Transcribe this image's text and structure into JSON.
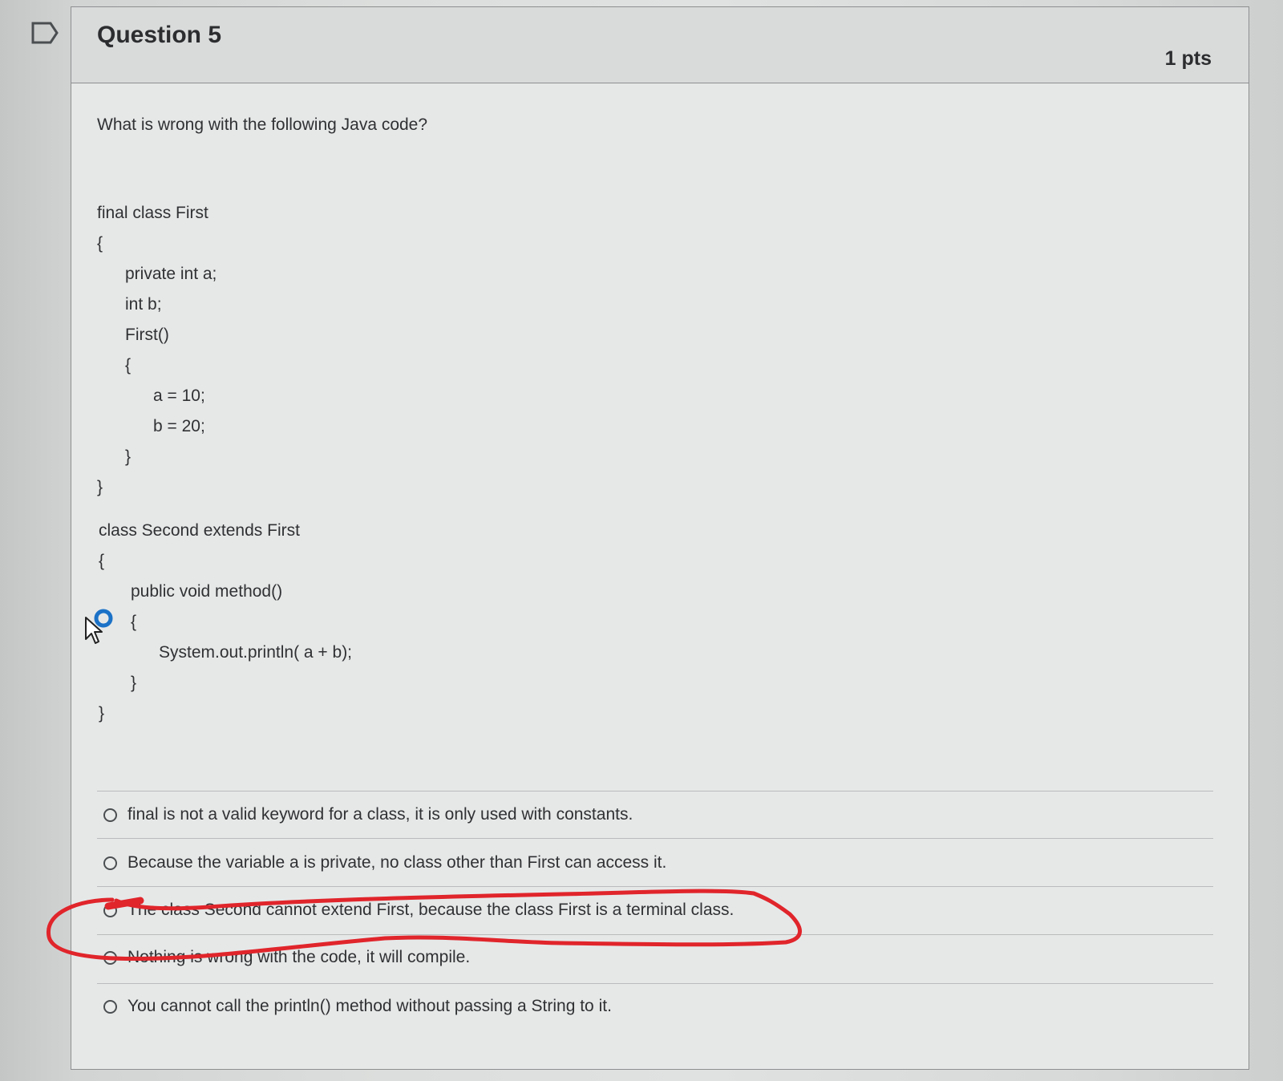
{
  "question": {
    "title": "Question 5",
    "points": "1 pts",
    "prompt": "What is wrong with the following Java code?"
  },
  "code": {
    "lines": [
      "final class First",
      "{",
      "private int a;",
      "int b;",
      "First()",
      "{",
      "a = 10;",
      "b = 20;",
      "}",
      "}",
      "class Second extends First",
      "{",
      "public void method()",
      "{",
      "System.out.println( a + b);",
      "}",
      "}"
    ]
  },
  "answers": [
    "final is not a valid keyword for a class, it is only used with constants.",
    "Because the variable a is private, no class other than First can access it.",
    "The class Second cannot extend First, because the class First is a terminal class.",
    "Nothing is wrong with the code, it will compile.",
    "You cannot call the println() method without passing a String to it."
  ],
  "colors": {
    "annotation": "#e0252b",
    "cursor_ring": "#1b72c7",
    "text": "#2f3133"
  },
  "icons": {
    "flag": "flag-icon",
    "cursor": "mouse-pointer-icon"
  }
}
